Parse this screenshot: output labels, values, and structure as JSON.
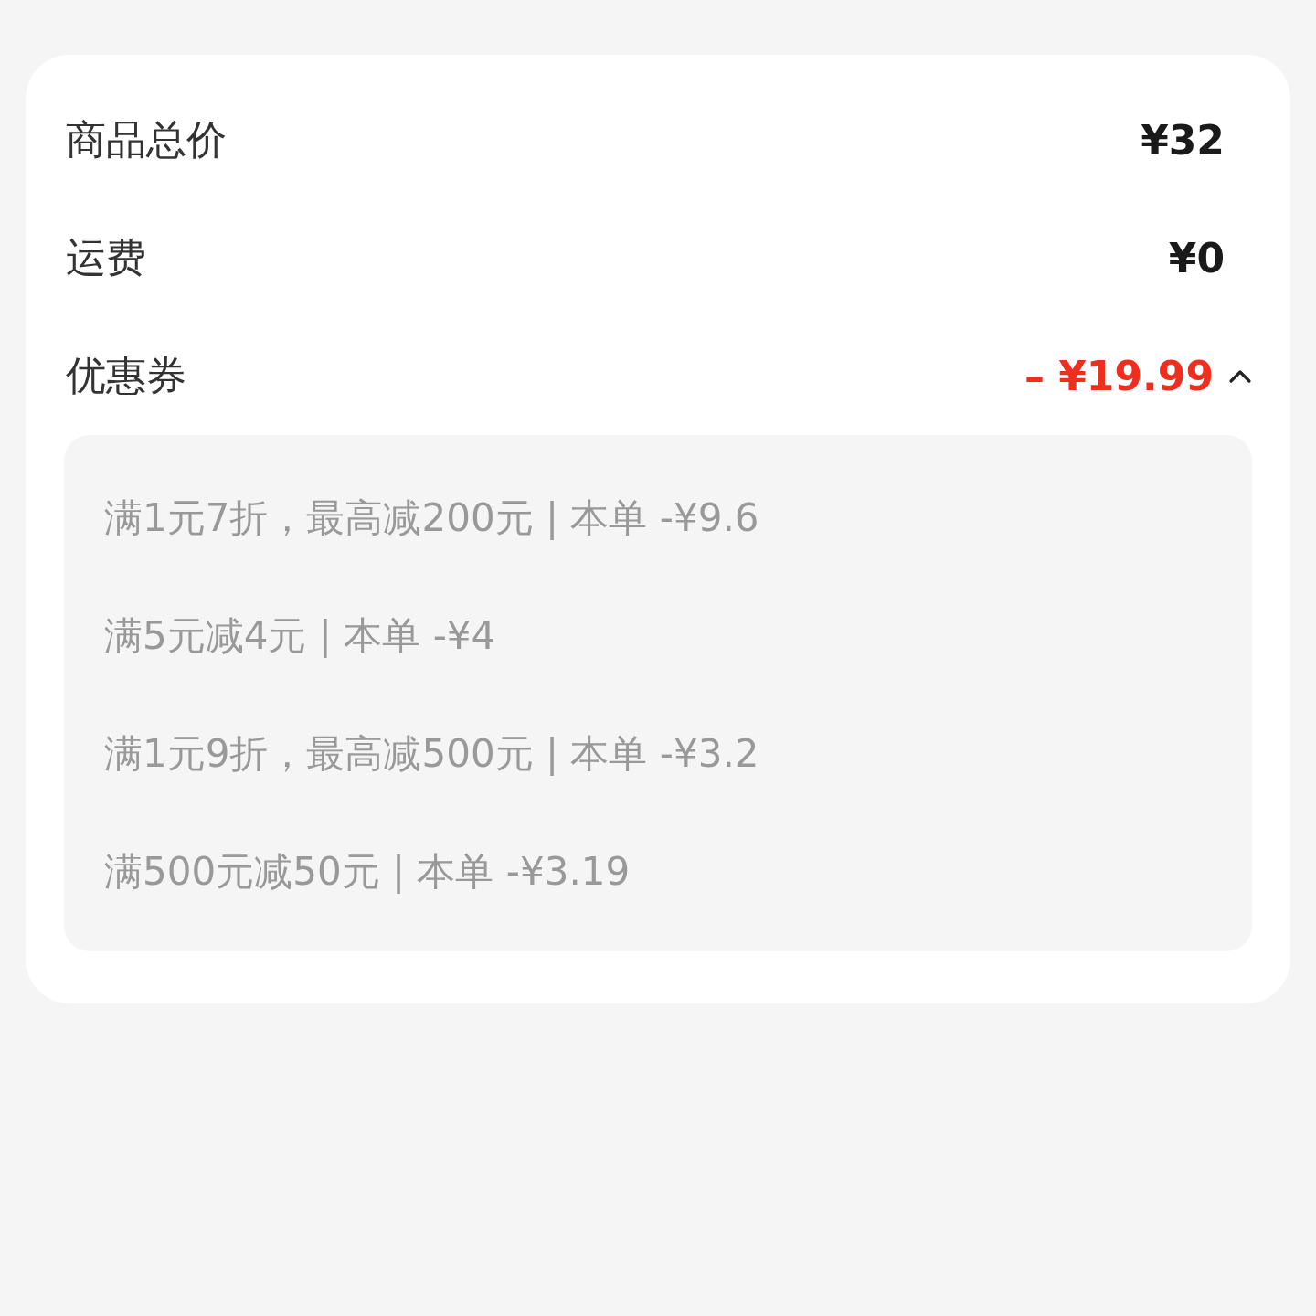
{
  "summary": {
    "rows": [
      {
        "kind": "plain",
        "label": "商品总价",
        "value": "¥32"
      },
      {
        "kind": "plain",
        "label": "运费",
        "value": "¥0"
      },
      {
        "kind": "discount",
        "label": "优惠券",
        "value": "– ¥19.99",
        "expanded": true,
        "coupons": [
          "满1元7折，最高减200元 | 本单 -¥9.6",
          "满5元减4元 | 本单 -¥4",
          "满1元9折，最高减500元 | 本单 -¥3.2",
          "满500元减50元 | 本单 -¥3.19"
        ]
      }
    ]
  }
}
